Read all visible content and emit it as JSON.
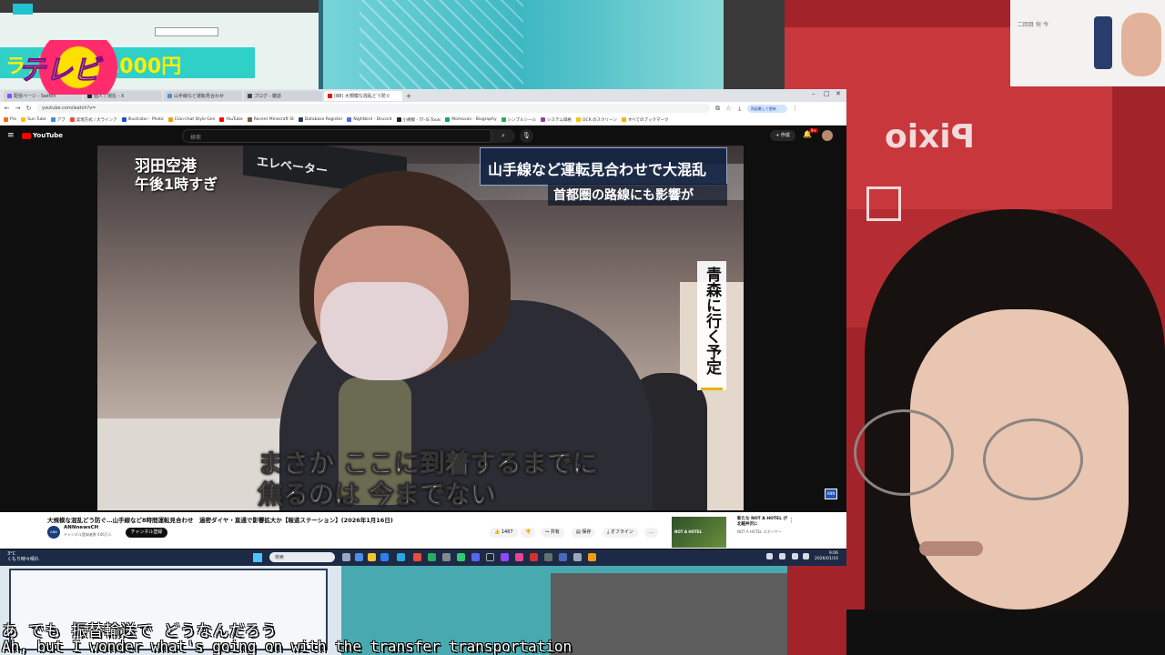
{
  "background": {
    "monitor_banner": "ラブちゃん1000円",
    "webcam_inset_text": "二回目 何 今"
  },
  "browser": {
    "tabs": [
      {
        "label": "配信ページ - Switch",
        "active": false,
        "color": "#9146ff"
      },
      {
        "label": "個人 / 現在 - X",
        "active": false,
        "color": "#222222"
      },
      {
        "label": "山手線など運転見合わせ",
        "active": false,
        "color": "#4a90d9"
      },
      {
        "label": "ブログ - 雑誌",
        "active": false,
        "color": "#444444"
      },
      {
        "label": "(88) 大規模な混乱どう防ぐ",
        "active": true,
        "color": "#ff0000"
      }
    ],
    "new_tab_label": "+",
    "url": "youtube.com/watch?v=",
    "profile_label": "再起動して更新",
    "bookmarks": [
      {
        "label": "Pro",
        "color": "#ff6b00"
      },
      {
        "label": "Sun Tube",
        "color": "#ffbf00"
      },
      {
        "label": "アプ",
        "color": "#3c8dde"
      },
      {
        "label": "実現方式 / 大ラインア",
        "color": "#e74c3c"
      },
      {
        "label": "Illustrator - Photo",
        "color": "#1f4bd8"
      },
      {
        "label": "Clan-chat Style Gen",
        "color": "#f39c12"
      },
      {
        "label": "YouTube",
        "color": "#ff0000"
      },
      {
        "label": "Recent Minecraft St",
        "color": "#7a5c3e"
      },
      {
        "label": "Database Register",
        "color": "#2c3e50"
      },
      {
        "label": "Nightbird - Discord",
        "color": "#5865f2"
      },
      {
        "label": "小規模 - TF-IS Tools",
        "color": "#222222"
      },
      {
        "label": "Momovan - Biography",
        "color": "#16a085"
      },
      {
        "label": "シンプルシール",
        "color": "#27ae60"
      },
      {
        "label": "システム価格",
        "color": "#8e44ad"
      },
      {
        "label": "OCR のスクリーン",
        "color": "#f1c40f"
      },
      {
        "label": "すべてのブックマーク",
        "color": "#f5b300"
      }
    ]
  },
  "youtube": {
    "logo_label": "YouTube",
    "search_placeholder": "検索",
    "create_label": "+ 作成",
    "notifications_badge": "9+",
    "channel_logo": "テレビ朝日",
    "video": {
      "location_line1": "羽田空港",
      "location_line2": "午後1時すぎ",
      "headline": "山手線など運転見合わせで大混乱",
      "subheadline": "首都圏の路線にも影響が",
      "vertical_caption": "青森に行く予定",
      "subtitle_line1": "まさか ここに到着するまでに",
      "subtitle_line2": "焦るのは 今までない",
      "sign_text": "エレベーター",
      "badge": "ANN"
    },
    "info": {
      "title": "大規模な混乱どう防ぐ…山手線など8時間運転見合わせ　過密ダイヤ・直通で影響拡大か【報道ステーション】(2026年1月16日)",
      "channel_avatar_text": "ANN",
      "channel_name": "ANNnewsCH",
      "channel_subs": "チャンネル登録者数 446万人",
      "subscribe_label": "チャンネル登録",
      "likes": "1467",
      "share_label": "共有",
      "save_label": "保存",
      "offline_label": "オフライン",
      "more_label": "…"
    },
    "recommended": {
      "thumb_text": "NOT A HOTEL",
      "title": "新たな NOT A HOTEL が北軽井沢に",
      "channel": "NOT A HOTEL スポンサー"
    }
  },
  "taskbar": {
    "weather_temp": "3°C",
    "weather_desc": "くもり時々晴れ",
    "search_label": "検索",
    "time": "9:06",
    "date": "2026/01/16"
  },
  "stream_captions": {
    "japanese": "あ でも 振替輸送で どうなんだろう",
    "english": "Ah, but I wonder what's going on with the transfer transportation"
  }
}
